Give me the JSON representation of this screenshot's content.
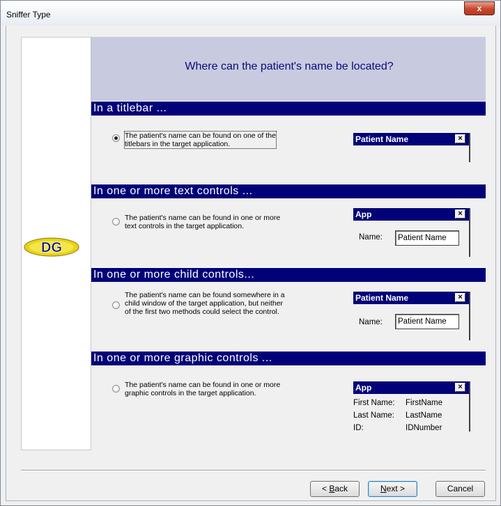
{
  "window": {
    "title": "Sniffer Type",
    "close_glyph": "x"
  },
  "logo": {
    "text": "DG",
    "icon": "dg-logo-icon"
  },
  "header": {
    "question": "Where can the patient's name be located?"
  },
  "sections": [
    {
      "heading": "In a titlebar ...",
      "option_lines": [
        "The patient's name can be found on one of the",
        "titlebars in the target application."
      ],
      "selected": true,
      "preview": {
        "title": "Patient Name"
      }
    },
    {
      "heading": "In one or more text controls ...",
      "option_lines": [
        "The patient's name can be found in one or more",
        "text controls in the target application."
      ],
      "selected": false,
      "preview": {
        "title": "App",
        "label": "Name:",
        "field": "Patient Name"
      }
    },
    {
      "heading": "In one or more child controls...",
      "option_lines": [
        "The patient's name can be found somewhere in a",
        "child window of the target application, but neither",
        "of the first two methods could select the control."
      ],
      "selected": false,
      "preview": {
        "title": "Patient Name",
        "label": "Name:",
        "field": "Patient Name"
      }
    },
    {
      "heading": "In one or more graphic controls ...",
      "option_lines": [
        "The patient's name can be found in one or more",
        "graphic controls in the target application."
      ],
      "selected": false,
      "preview": {
        "title": "App",
        "rows": [
          {
            "label": "First Name:",
            "value": "FirstName"
          },
          {
            "label": "Last Name:",
            "value": "LastName"
          },
          {
            "label": "ID:",
            "value": "IDNumber"
          }
        ]
      }
    }
  ],
  "buttons": {
    "back_prefix": "< ",
    "back_mnemonic": "B",
    "back_rest": "ack",
    "next_mnemonic": "N",
    "next_rest": "ext >",
    "cancel": "Cancel"
  },
  "colors": {
    "section_bar": "#020278",
    "header_bg": "#c8cbe0",
    "header_text": "#0a0a78"
  }
}
